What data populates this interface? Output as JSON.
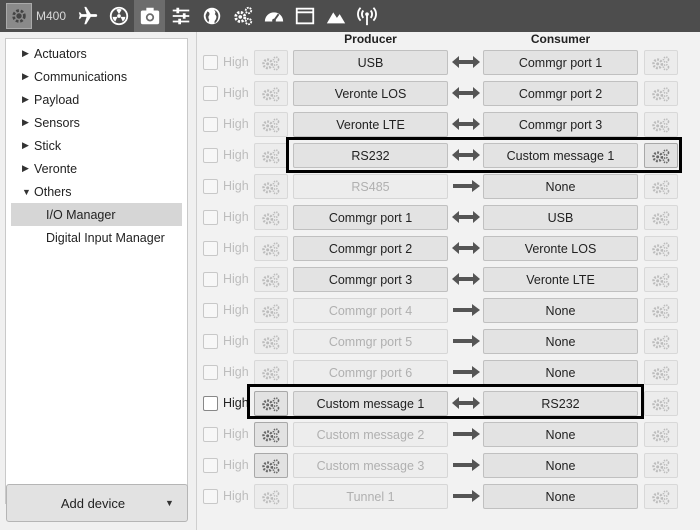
{
  "toolbar": {
    "device_label": "M400",
    "buttons": [
      "airplane-icon",
      "radiation-icon",
      "camera-icon",
      "sliders-icon",
      "globe-icon",
      "gears-icon",
      "gauge-icon",
      "window-icon",
      "mountain-icon",
      "signal-icon"
    ],
    "active": "camera-icon"
  },
  "sidebar": {
    "items": [
      {
        "label": "Actuators",
        "expanded": false
      },
      {
        "label": "Communications",
        "expanded": false
      },
      {
        "label": "Payload",
        "expanded": false
      },
      {
        "label": "Sensors",
        "expanded": false
      },
      {
        "label": "Stick",
        "expanded": false
      },
      {
        "label": "Veronte",
        "expanded": false
      },
      {
        "label": "Others",
        "expanded": true
      }
    ],
    "children": [
      {
        "label": "I/O Manager",
        "selected": true
      },
      {
        "label": "Digital Input Manager",
        "selected": false
      }
    ],
    "add_device_label": "Add device"
  },
  "main": {
    "producer_header": "Producer",
    "consumer_header": "Consumer",
    "priority_label": "High",
    "rows": [
      {
        "producer": "USB",
        "consumer": "Commgr port 1",
        "dir": "both",
        "active": true,
        "high_on": false,
        "pgear_on": false,
        "cgear_on": false
      },
      {
        "producer": "Veronte LOS",
        "consumer": "Commgr port 2",
        "dir": "both",
        "active": true,
        "high_on": false,
        "pgear_on": false,
        "cgear_on": false
      },
      {
        "producer": "Veronte LTE",
        "consumer": "Commgr port 3",
        "dir": "both",
        "active": true,
        "high_on": false,
        "pgear_on": false,
        "cgear_on": false
      },
      {
        "producer": "RS232",
        "consumer": "Custom message 1",
        "dir": "both",
        "active": true,
        "high_on": false,
        "pgear_on": false,
        "cgear_on": true
      },
      {
        "producer": "RS485",
        "consumer": "None",
        "dir": "right",
        "active": false,
        "high_on": false,
        "pgear_on": false,
        "cgear_on": false
      },
      {
        "producer": "Commgr port 1",
        "consumer": "USB",
        "dir": "both",
        "active": true,
        "high_on": false,
        "pgear_on": false,
        "cgear_on": false
      },
      {
        "producer": "Commgr port 2",
        "consumer": "Veronte LOS",
        "dir": "both",
        "active": true,
        "high_on": false,
        "pgear_on": false,
        "cgear_on": false
      },
      {
        "producer": "Commgr port 3",
        "consumer": "Veronte LTE",
        "dir": "both",
        "active": true,
        "high_on": false,
        "pgear_on": false,
        "cgear_on": false
      },
      {
        "producer": "Commgr port 4",
        "consumer": "None",
        "dir": "right",
        "active": false,
        "high_on": false,
        "pgear_on": false,
        "cgear_on": false
      },
      {
        "producer": "Commgr port 5",
        "consumer": "None",
        "dir": "right",
        "active": false,
        "high_on": false,
        "pgear_on": false,
        "cgear_on": false
      },
      {
        "producer": "Commgr port 6",
        "consumer": "None",
        "dir": "right",
        "active": false,
        "high_on": false,
        "pgear_on": false,
        "cgear_on": false
      },
      {
        "producer": "Custom message 1",
        "consumer": "RS232",
        "dir": "both",
        "active": true,
        "high_on": true,
        "pgear_on": true,
        "cgear_on": false
      },
      {
        "producer": "Custom message 2",
        "consumer": "None",
        "dir": "right",
        "active": false,
        "high_on": false,
        "pgear_on": true,
        "cgear_on": false
      },
      {
        "producer": "Custom message 3",
        "consumer": "None",
        "dir": "right",
        "active": false,
        "high_on": false,
        "pgear_on": true,
        "cgear_on": false
      },
      {
        "producer": "Tunnel 1",
        "consumer": "None",
        "dir": "right",
        "active": false,
        "high_on": false,
        "pgear_on": false,
        "cgear_on": false
      }
    ]
  }
}
